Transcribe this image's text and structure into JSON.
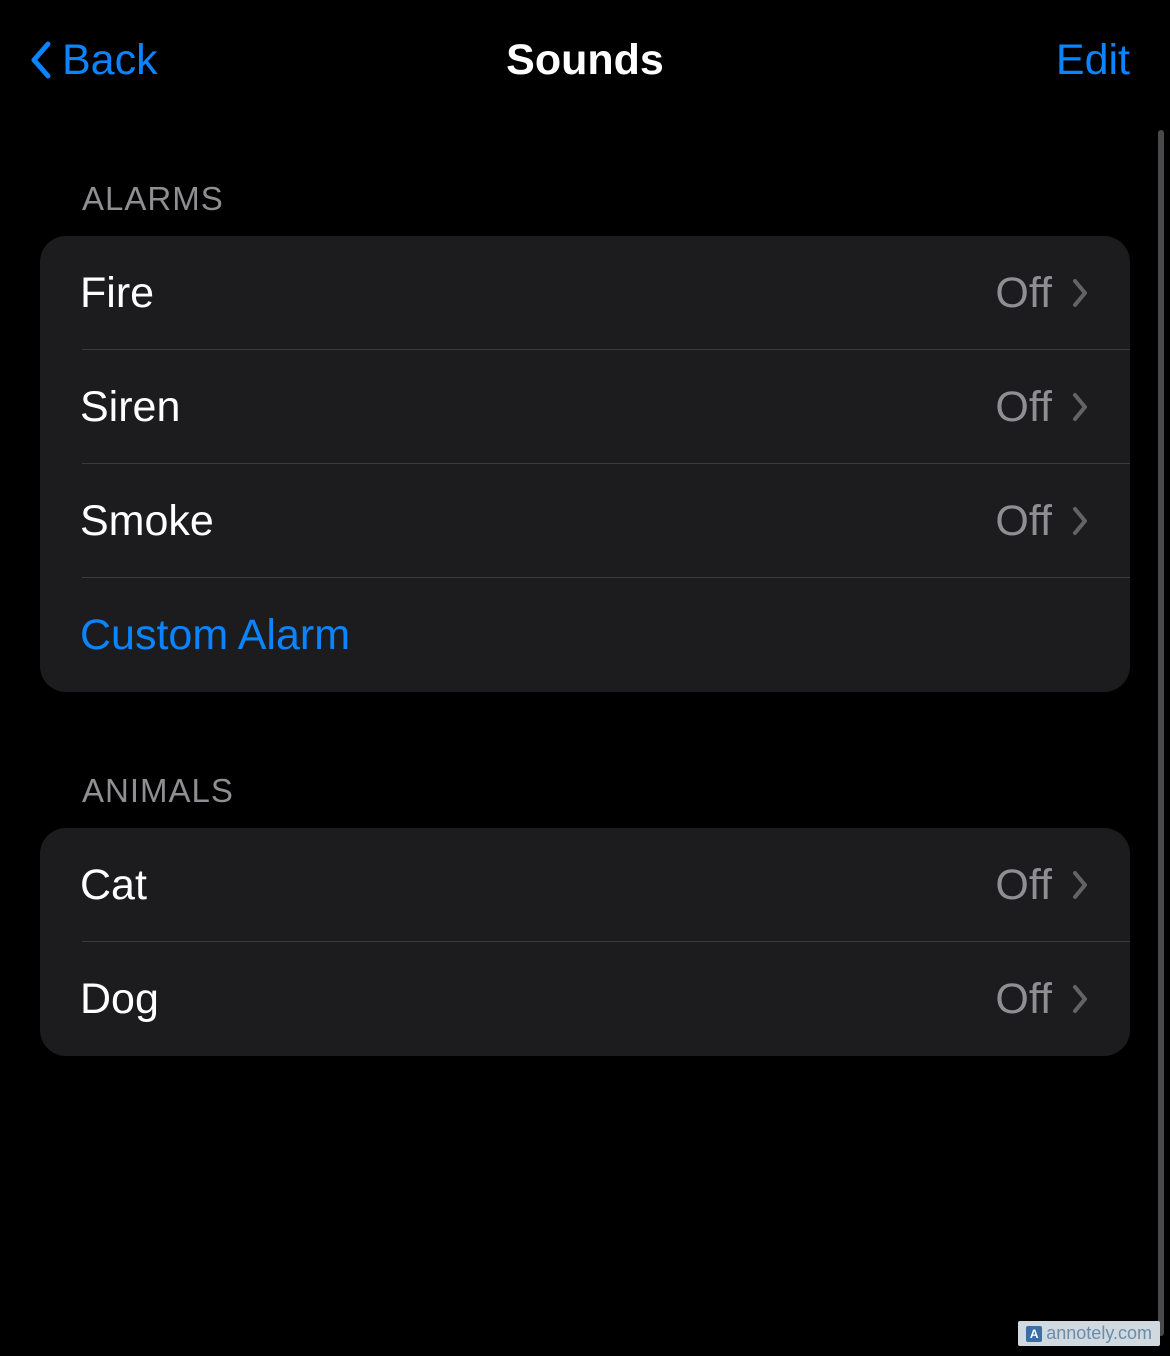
{
  "nav": {
    "back_label": "Back",
    "title": "Sounds",
    "edit_label": "Edit"
  },
  "sections": {
    "alarms": {
      "header": "ALARMS",
      "items": [
        {
          "label": "Fire",
          "value": "Off"
        },
        {
          "label": "Siren",
          "value": "Off"
        },
        {
          "label": "Smoke",
          "value": "Off"
        }
      ],
      "custom_label": "Custom Alarm"
    },
    "animals": {
      "header": "ANIMALS",
      "items": [
        {
          "label": "Cat",
          "value": "Off"
        },
        {
          "label": "Dog",
          "value": "Off"
        }
      ]
    }
  },
  "watermark": "annotely.com"
}
